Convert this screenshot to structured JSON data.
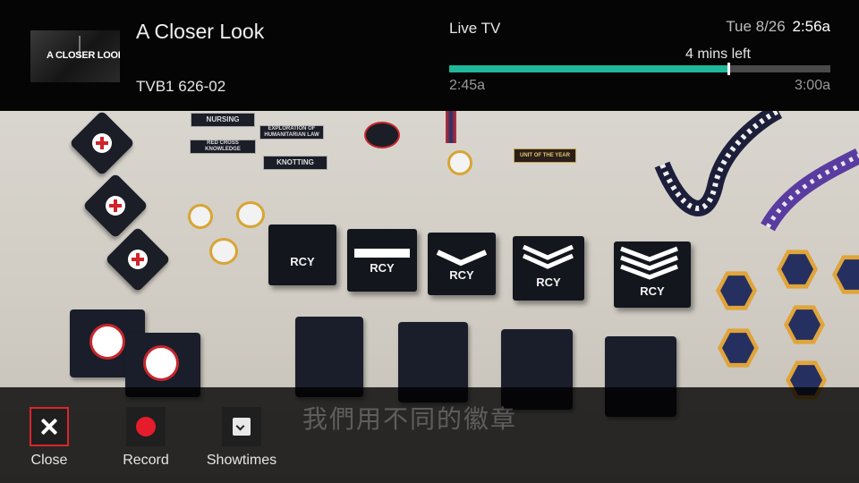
{
  "header": {
    "thumbnail_text": "A CLOSER LOOK",
    "show_title": "A Closer Look",
    "channel": "TVB1 626-02",
    "live_label": "Live TV",
    "date": "Tue 8/26",
    "time": "2:56a",
    "remaining": "4 mins left",
    "start_time": "2:45a",
    "end_time": "3:00a",
    "progress": 0.73
  },
  "video": {
    "patch_labels": [
      "NURSING",
      "EXPLORATION OF HUMANITARIAN LAW",
      "RED CROSS KNOWLEDGE",
      "KNOTTING",
      "UNIT OF THE YEAR"
    ],
    "epaulette_text": "RCY"
  },
  "subtitle": "我們用不同的徽章",
  "actions": [
    {
      "label": "Close",
      "icon": "close-icon"
    },
    {
      "label": "Record",
      "icon": "record-icon"
    },
    {
      "label": "Showtimes",
      "icon": "clock-icon"
    }
  ],
  "colors": {
    "progress": "#1fb89a",
    "record": "#e51c2c",
    "focus": "#d8262c"
  }
}
